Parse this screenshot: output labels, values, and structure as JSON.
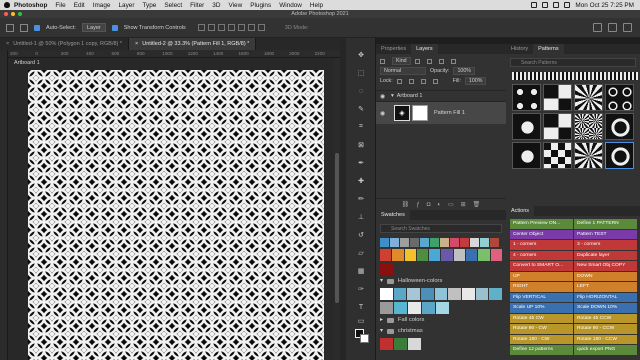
{
  "menubar": {
    "app": "Photoshop",
    "items": [
      "File",
      "Edit",
      "Image",
      "Layer",
      "Type",
      "Select",
      "Filter",
      "3D",
      "View",
      "Plugins",
      "Window",
      "Help"
    ],
    "datetime": "Mon Oct 25  7:25 PM"
  },
  "window": {
    "title": "Adobe Photoshop 2021"
  },
  "options": {
    "auto_select_label": "Auto-Select:",
    "auto_select_value": "Layer",
    "transform_label": "Show Transform Controls",
    "mode_3d": "3D Mode:"
  },
  "doc_tabs": [
    {
      "label": "Untitled-1 @ 50% (Polygon 1 copy, RGB/8) *",
      "active": false
    },
    {
      "label": "Untitled-2 @ 33.3% (Pattern Fill 1, RGB/8) *",
      "active": true
    }
  ],
  "ruler": {
    "ticks": [
      "200",
      "0",
      "200",
      "400",
      "600",
      "800",
      "1000",
      "1200",
      "1400",
      "1600",
      "1800",
      "2000",
      "2200"
    ]
  },
  "canvas": {
    "artboard_label": "Artboard 1"
  },
  "layers_panel": {
    "tabs": [
      "Properties",
      "Layers"
    ],
    "active_tab": "Layers",
    "kind_label": "Kind",
    "blend_mode": "Normal",
    "opacity_label": "Opacity:",
    "opacity_value": "100%",
    "lock_label": "Lock:",
    "fill_label": "Fill:",
    "fill_value": "100%",
    "layers": [
      {
        "name": "Artboard 1",
        "type": "artboard"
      },
      {
        "name": "Pattern Fill 1",
        "type": "fill"
      }
    ]
  },
  "patterns_panel": {
    "tabs": [
      "History",
      "Patterns"
    ],
    "active_tab": "Patterns",
    "search_placeholder": "Search Patterns"
  },
  "swatches_panel": {
    "title": "Swatches",
    "search_placeholder": "Search Swatches",
    "top_colors": [
      "#3e8fc8",
      "#7fb0d8",
      "#9e9e9e",
      "#6a6a6a",
      "#5aa7d0",
      "#3fa06a",
      "#c9b28a",
      "#d44a6a",
      "#c33b3b",
      "#d8d8d8",
      "#8fd0d0",
      "#b0483a"
    ],
    "row2_colors": [
      "#d04030",
      "#e08a2c",
      "#f3c12d",
      "#4e8f3f",
      "#4aa8d8",
      "#6a58a8",
      "#c0c0c0",
      "#3a6fb0",
      "#7ac06a",
      "#e06080"
    ],
    "row3_colors": [
      "#8a1010"
    ],
    "groups": [
      {
        "name": "Halloween-colors",
        "colors": [
          "#ffffff",
          "#5aa7c8",
          "#a6c6d8",
          "#4e8fb8",
          "#8fc3d6",
          "#c0c0c0",
          "#e8e8e8",
          "#9ac0d0",
          "#5fb0c8"
        ]
      },
      {
        "name": "Fall colors",
        "colors": []
      },
      {
        "name": "christmas",
        "colors": [
          "#c03030",
          "#3a7d3a",
          "#d8d8d8"
        ]
      }
    ],
    "halloween_row2": [
      "#9a9a9a",
      "#56b5d0",
      "#e8e8e8",
      "#5aa6c6",
      "#a3d7e6"
    ]
  },
  "actions_panel": {
    "title": "Actions",
    "items": [
      {
        "label": "Pattern Preview ON...",
        "color": "#5a8a3a"
      },
      {
        "label": "Define 1 PATTERN",
        "color": "#5a8a3a"
      },
      {
        "label": "Center Object",
        "color": "#7a3aa8"
      },
      {
        "label": "Pattern TEST",
        "color": "#7a3aa8"
      },
      {
        "label": "1 - corners",
        "color": "#c03838"
      },
      {
        "label": "3 - corners",
        "color": "#c03838"
      },
      {
        "label": "4 - corners",
        "color": "#c03838"
      },
      {
        "label": "Duplicate layer",
        "color": "#c03838"
      },
      {
        "label": "Convert to SMART O...",
        "color": "#c03838"
      },
      {
        "label": "New Smart Obj COPY",
        "color": "#c03838"
      },
      {
        "label": "UP",
        "color": "#d0802a"
      },
      {
        "label": "DOWN",
        "color": "#d0802a"
      },
      {
        "label": "RIGHT",
        "color": "#d0802a"
      },
      {
        "label": "LEFT",
        "color": "#d0802a"
      },
      {
        "label": "Flip VERTICAL",
        "color": "#3a70b0"
      },
      {
        "label": "Flip HORIZONTAL",
        "color": "#3a70b0"
      },
      {
        "label": "Scale UP 10%",
        "color": "#3a70b0"
      },
      {
        "label": "Scale DOWN 10%",
        "color": "#3a70b0"
      },
      {
        "label": "Rotate 45 CW",
        "color": "#b8962a"
      },
      {
        "label": "Rotate 45 CCW",
        "color": "#b8962a"
      },
      {
        "label": "Rotate 90 - CW",
        "color": "#b8962a"
      },
      {
        "label": "Rotate 90 - CCW",
        "color": "#b8962a"
      },
      {
        "label": "Rotate 180 - CW",
        "color": "#b8962a"
      },
      {
        "label": "Rotate 180 - CCW",
        "color": "#b8962a"
      },
      {
        "label": "Define 12 patterns",
        "color": "#5a8a3a"
      },
      {
        "label": "quick export PNG",
        "color": "#5a8a3a"
      }
    ]
  }
}
